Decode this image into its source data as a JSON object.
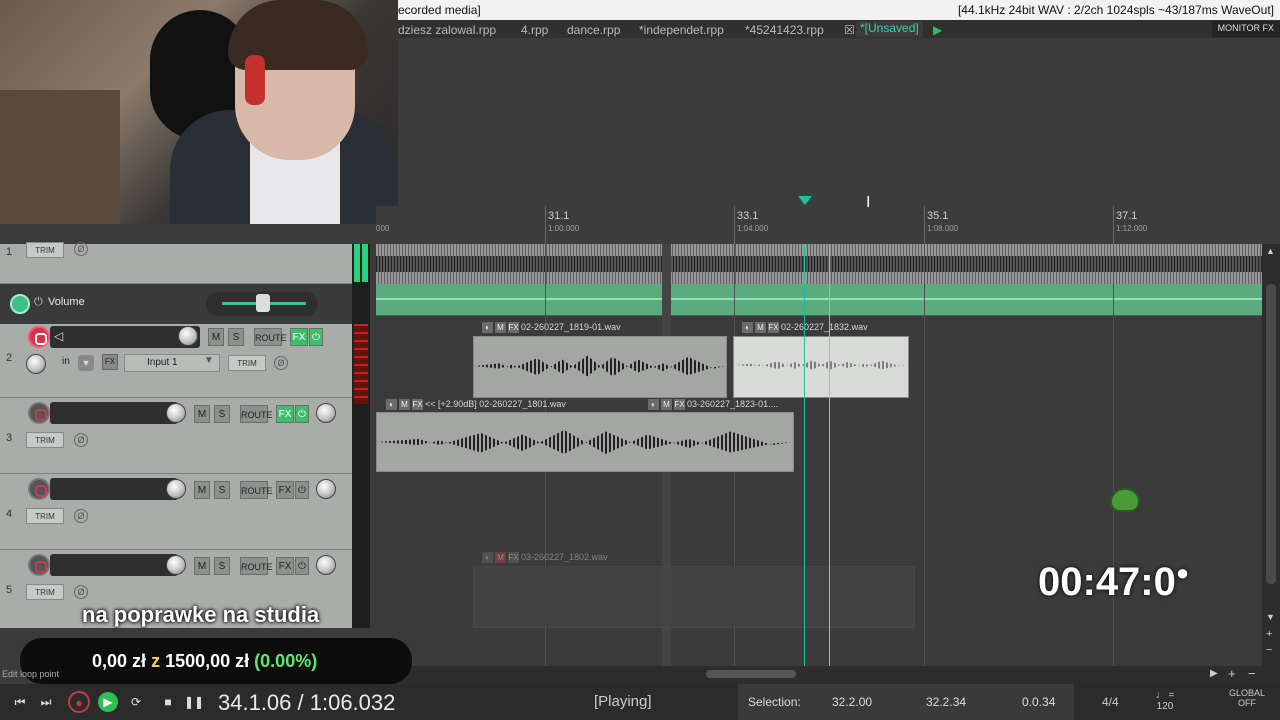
{
  "titlebar": {
    "left": "ecorded media]",
    "right": "[44.1kHz 24bit WAV : 2/2ch 1024spls ~43/187ms WaveOut]"
  },
  "tabs": [
    "dziesz zalowal.rpp",
    "4.rpp",
    "dance.rpp",
    "*independet.rpp",
    "*45241423.rpp",
    "*[Unsaved]"
  ],
  "monitor_fx": "MONITOR FX",
  "ruler": {
    "start_label": "000",
    "marks": [
      {
        "bar": "31.1",
        "time": "1:00.000"
      },
      {
        "bar": "33.1",
        "time": "1:04.000"
      },
      {
        "bar": "35.1",
        "time": "1:08.000"
      },
      {
        "bar": "37.1",
        "time": "1:12.000"
      }
    ]
  },
  "tcp": {
    "trim": "TRIM",
    "phase": "Ø",
    "envelope_label": "Volume",
    "track2_input_mode": "in",
    "track2_input": "Input 1",
    "mute": "M",
    "solo": "S",
    "route": "ROUTE",
    "fx": "FX",
    "power": "⏻",
    "tracks": [
      {
        "num": "1"
      },
      {
        "num": "2"
      },
      {
        "num": "3"
      },
      {
        "num": "4"
      },
      {
        "num": "5"
      }
    ]
  },
  "items": {
    "a": "02-260227_1819-01.wav",
    "b": "02-260227_1832.wav",
    "c": "<< [+2.90dB] 02-260227_1801.wav",
    "d": "03-260227_1823-01....",
    "e": "03-260227_1802.wav"
  },
  "overlay": {
    "subtitle": "na poprawke na studia",
    "donation_amount": "0,00 zł",
    "donation_z": "z",
    "donation_goal": "1500,00 zł",
    "donation_pct": "(0.00%)",
    "edit_hint": "Edit loop point",
    "timer": "00:47:0"
  },
  "transport": {
    "position": "34.1.06 / 1:06.032",
    "state": "[Playing]",
    "selection_label": "Selection:",
    "sel_start": "32.2.00",
    "sel_end": "32.2.34",
    "sel_len": "0.0.34",
    "time_sig": "4/4",
    "bpm": "120",
    "global": "GLOBAL",
    "global_state": "OFF"
  },
  "colors": {
    "accent": "#1fbf9a",
    "play": "#2dbf55",
    "record": "#d9334b",
    "fx_on": "#3fbf6a"
  }
}
